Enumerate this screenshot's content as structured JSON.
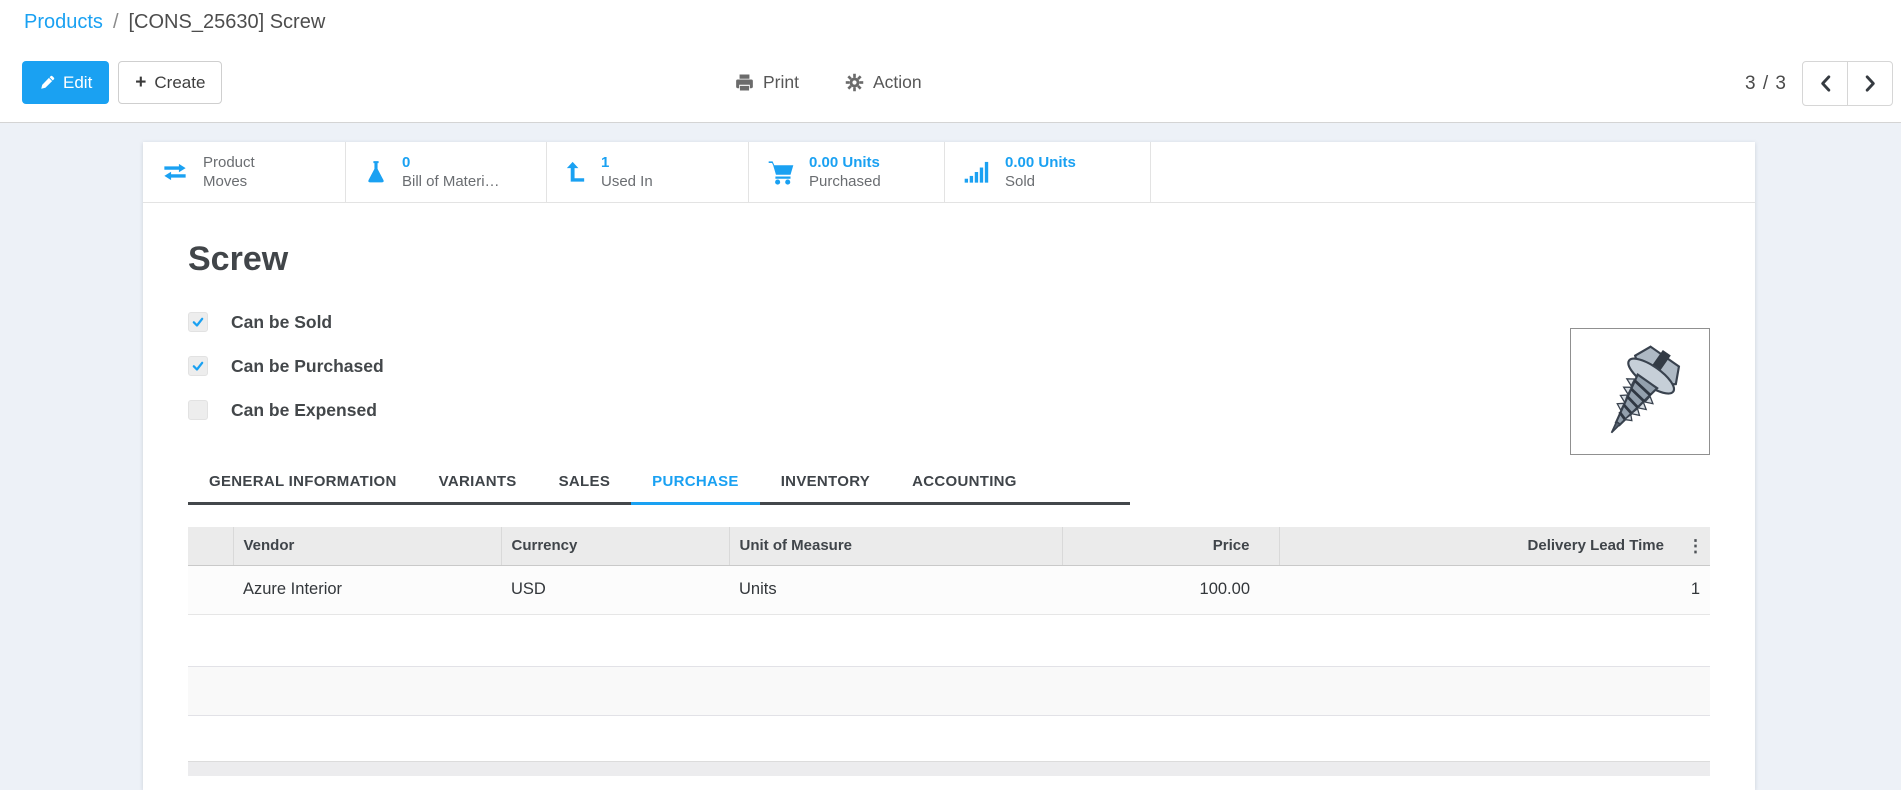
{
  "breadcrumb": {
    "link": "Products",
    "separator": "/",
    "current": "[CONS_25630] Screw"
  },
  "toolbar": {
    "edit_label": "Edit",
    "create_label": "Create",
    "print_label": "Print",
    "action_label": "Action",
    "pager_count": "3 / 3"
  },
  "stat_buttons": [
    {
      "icon": "exchange-icon",
      "line1": "Product",
      "line2": "Moves"
    },
    {
      "icon": "flask-icon",
      "line1": "0",
      "line2": "Bill of Materi…"
    },
    {
      "icon": "level-up-icon",
      "line1": "1",
      "line2": "Used In"
    },
    {
      "icon": "cart-icon",
      "line1": "0.00 Units",
      "line2": "Purchased"
    },
    {
      "icon": "bar-chart-icon",
      "line1": "0.00 Units",
      "line2": "Sold"
    }
  ],
  "product": {
    "title": "Screw",
    "checkboxes": [
      {
        "label": "Can be Sold",
        "checked": true
      },
      {
        "label": "Can be Purchased",
        "checked": true
      },
      {
        "label": "Can be Expensed",
        "checked": false
      }
    ]
  },
  "tabs": {
    "items": [
      {
        "label": "GENERAL INFORMATION",
        "active": false
      },
      {
        "label": "VARIANTS",
        "active": false
      },
      {
        "label": "SALES",
        "active": false
      },
      {
        "label": "PURCHASE",
        "active": true
      },
      {
        "label": "INVENTORY",
        "active": false
      },
      {
        "label": "ACCOUNTING",
        "active": false
      }
    ]
  },
  "vendor_table": {
    "columns": [
      "Vendor",
      "Currency",
      "Unit of Measure",
      "Price",
      "Delivery Lead Time"
    ],
    "options_icon": "⋮",
    "rows": [
      [
        "Azure Interior",
        "USD",
        "Units",
        "100.00",
        "1"
      ]
    ]
  },
  "colors": {
    "accent_blue": "#1AA1F2",
    "dark_text": "#414549",
    "muted_text": "#6a6d71",
    "page_background": "#EDF1F7",
    "tab_underline_dark": "#43474b"
  }
}
